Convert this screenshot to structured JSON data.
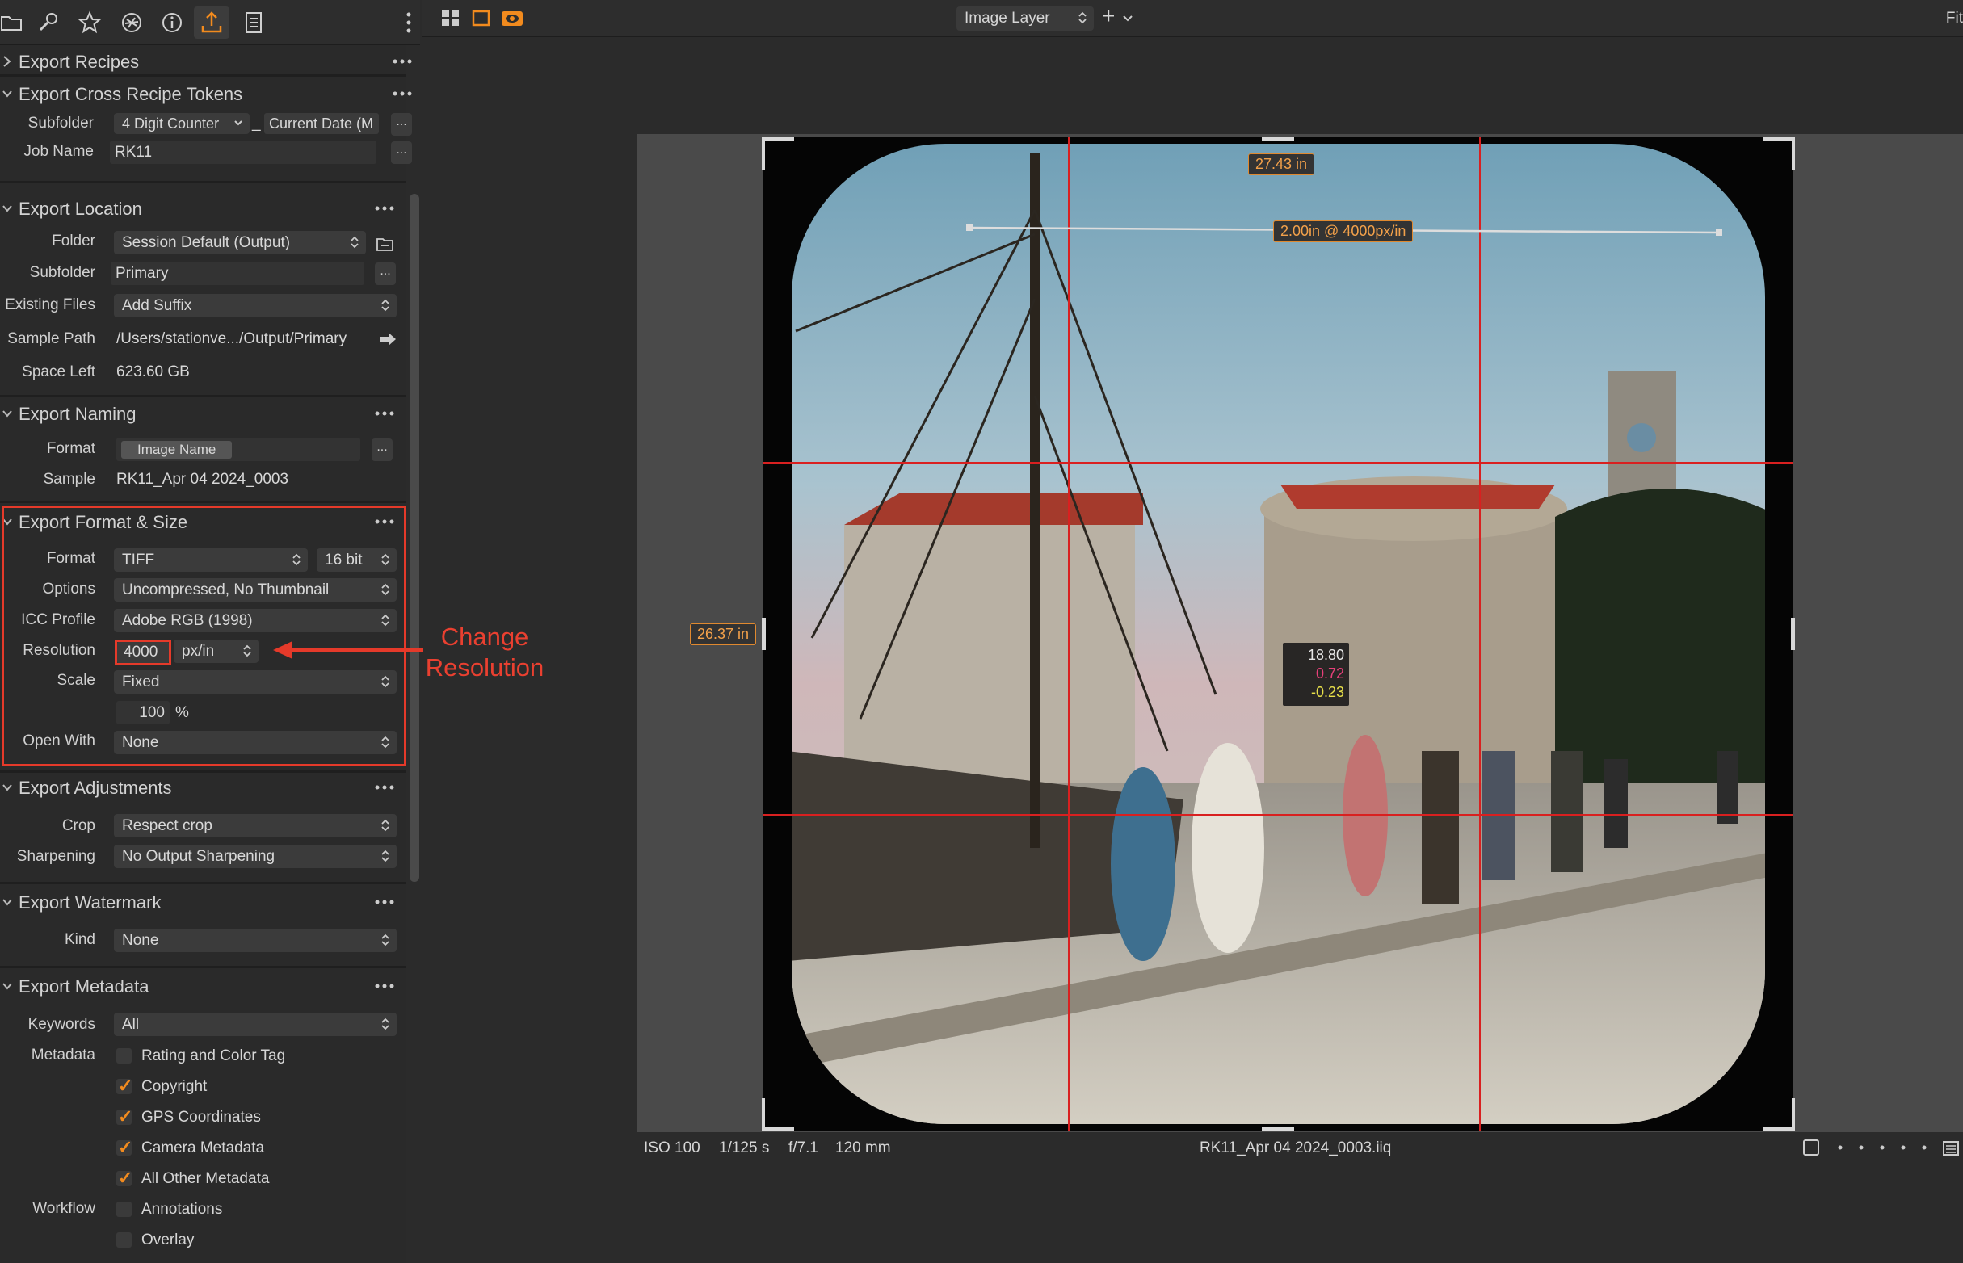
{
  "toolbar": {
    "tabs": [
      "folder-icon",
      "wrench-icon",
      "star-icon",
      "aperture-icon",
      "info-icon",
      "export-icon",
      "notes-icon"
    ],
    "active_tab": "export-icon"
  },
  "sections": {
    "recipes": {
      "title": "Export Recipes"
    },
    "tokens": {
      "title": "Export Cross Recipe Tokens",
      "subfolder_label": "Subfolder",
      "subfolder_token": "4 Digit Counter",
      "subfolder_sep": "_",
      "subfolder_token2": "Current Date (M",
      "jobname_label": "Job Name",
      "jobname_value": "RK11",
      "dots": "..."
    },
    "location": {
      "title": "Export Location",
      "folder_label": "Folder",
      "folder_value": "Session Default (Output)",
      "subfolder_label": "Subfolder",
      "subfolder_value": "Primary",
      "existing_label": "Existing Files",
      "existing_value": "Add Suffix",
      "sample_label": "Sample Path",
      "sample_value": "/Users/stationve.../Output/Primary",
      "space_label": "Space Left",
      "space_value": "623.60 GB"
    },
    "naming": {
      "title": "Export Naming",
      "format_label": "Format",
      "format_token": "Image Name",
      "sample_label": "Sample",
      "sample_value": "RK11_Apr 04 2024_0003"
    },
    "format": {
      "title": "Export Format & Size",
      "format_label": "Format",
      "format_value": "TIFF",
      "bit_value": "16 bit",
      "options_label": "Options",
      "options_value": "Uncompressed, No Thumbnail",
      "icc_label": "ICC Profile",
      "icc_value": "Adobe RGB (1998)",
      "resolution_label": "Resolution",
      "resolution_value": "4000",
      "resolution_unit": "px/in",
      "scale_label": "Scale",
      "scale_value": "Fixed",
      "scale_percent": "100",
      "percent_sign": "%",
      "openwith_label": "Open With",
      "openwith_value": "None"
    },
    "adjustments": {
      "title": "Export Adjustments",
      "crop_label": "Crop",
      "crop_value": "Respect crop",
      "sharpening_label": "Sharpening",
      "sharpening_value": "No Output Sharpening"
    },
    "watermark": {
      "title": "Export Watermark",
      "kind_label": "Kind",
      "kind_value": "None"
    },
    "metadata": {
      "title": "Export Metadata",
      "keywords_label": "Keywords",
      "keywords_value": "All",
      "metadata_label": "Metadata",
      "items": [
        {
          "label": "Rating and Color Tag",
          "checked": false
        },
        {
          "label": "Copyright",
          "checked": true
        },
        {
          "label": "GPS Coordinates",
          "checked": true
        },
        {
          "label": "Camera Metadata",
          "checked": true
        },
        {
          "label": "All Other Metadata",
          "checked": true
        }
      ],
      "workflow_label": "Workflow",
      "workflow_items": [
        {
          "label": "Annotations",
          "checked": false
        },
        {
          "label": "Overlay",
          "checked": false
        }
      ]
    }
  },
  "topbar": {
    "layer": "Image Layer",
    "plus": "+",
    "fit": "Fit"
  },
  "viewer": {
    "width_badge": "27.43 in",
    "height_badge": "26.37 in",
    "ruler_badge": "2.00in @ 4000px/in",
    "readout": {
      "l": "18.80",
      "a": "0.72",
      "b": "-0.23"
    }
  },
  "status": {
    "iso": "ISO 100",
    "shutter": "1/125 s",
    "aperture": "f/7.1",
    "focal": "120 mm",
    "filename": "RK11_Apr 04 2024_0003.iiq"
  },
  "annotation": {
    "line1": "Change",
    "line2": "Resolution"
  },
  "colors": {
    "accent": "#f28b1e",
    "annotation_red": "#e53a2a",
    "grid_red": "#d92020",
    "readout_a": "#e8407a",
    "readout_b": "#e8e04a"
  }
}
